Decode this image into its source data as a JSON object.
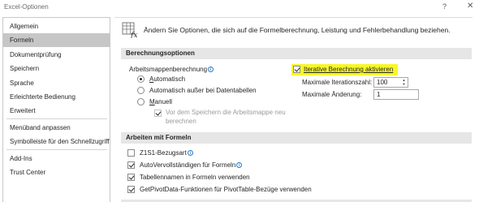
{
  "window": {
    "title": "Excel-Optionen",
    "help": "?",
    "close": "✕"
  },
  "sidebar": {
    "items": [
      {
        "label": "Allgemein"
      },
      {
        "label": "Formeln"
      },
      {
        "label": "Dokumentprüfung"
      },
      {
        "label": "Speichern"
      },
      {
        "label": "Sprache"
      },
      {
        "label": "Erleichterte Bedienung"
      },
      {
        "label": "Erweitert"
      },
      {
        "label": "Menüband anpassen"
      },
      {
        "label": "Symbolleiste für den Schnellzugriff"
      },
      {
        "label": "Add-Ins"
      },
      {
        "label": "Trust Center"
      }
    ],
    "selected": "Formeln"
  },
  "header": {
    "text": "Ändern Sie Optionen, die sich auf die Formelberechnung, Leistung und Fehlerbehandlung beziehen."
  },
  "calc": {
    "section_title": "Berechnungsoptionen",
    "workbook_calc_label": "Arbeitsmappenberechnung",
    "automatic": "Automatisch",
    "automatic_except_tables": "Automatisch außer bei Datentabellen",
    "manual": "Manuell",
    "recalc_before_save_line1": "Vor dem Speichern die Arbeitsmappe neu",
    "recalc_before_save_line2": "berechnen",
    "iterative_label": "Iterative Berechnung aktivieren",
    "max_iterations_label": "Maximale Iterationszahl:",
    "max_iterations_value": "100",
    "max_change_label": "Maximale Änderung:",
    "max_change_value": "1"
  },
  "formulas": {
    "section_title": "Arbeiten mit Formeln",
    "z1s1_label": "Z1S1-Bezugsart",
    "autocomplete_label": "AutoVervollständigen für Formeln",
    "table_names_label": "Tabellennamen in Formeln verwenden",
    "getpivotdata_label": "GetPivotData-Funktionen für PivotTable-Bezüge verwenden"
  },
  "colors": {
    "highlight": "#f7f72a",
    "selected_nav": "#c6c6c6",
    "section_bg": "#e6e6e6",
    "info_icon": "#2b78c5"
  }
}
